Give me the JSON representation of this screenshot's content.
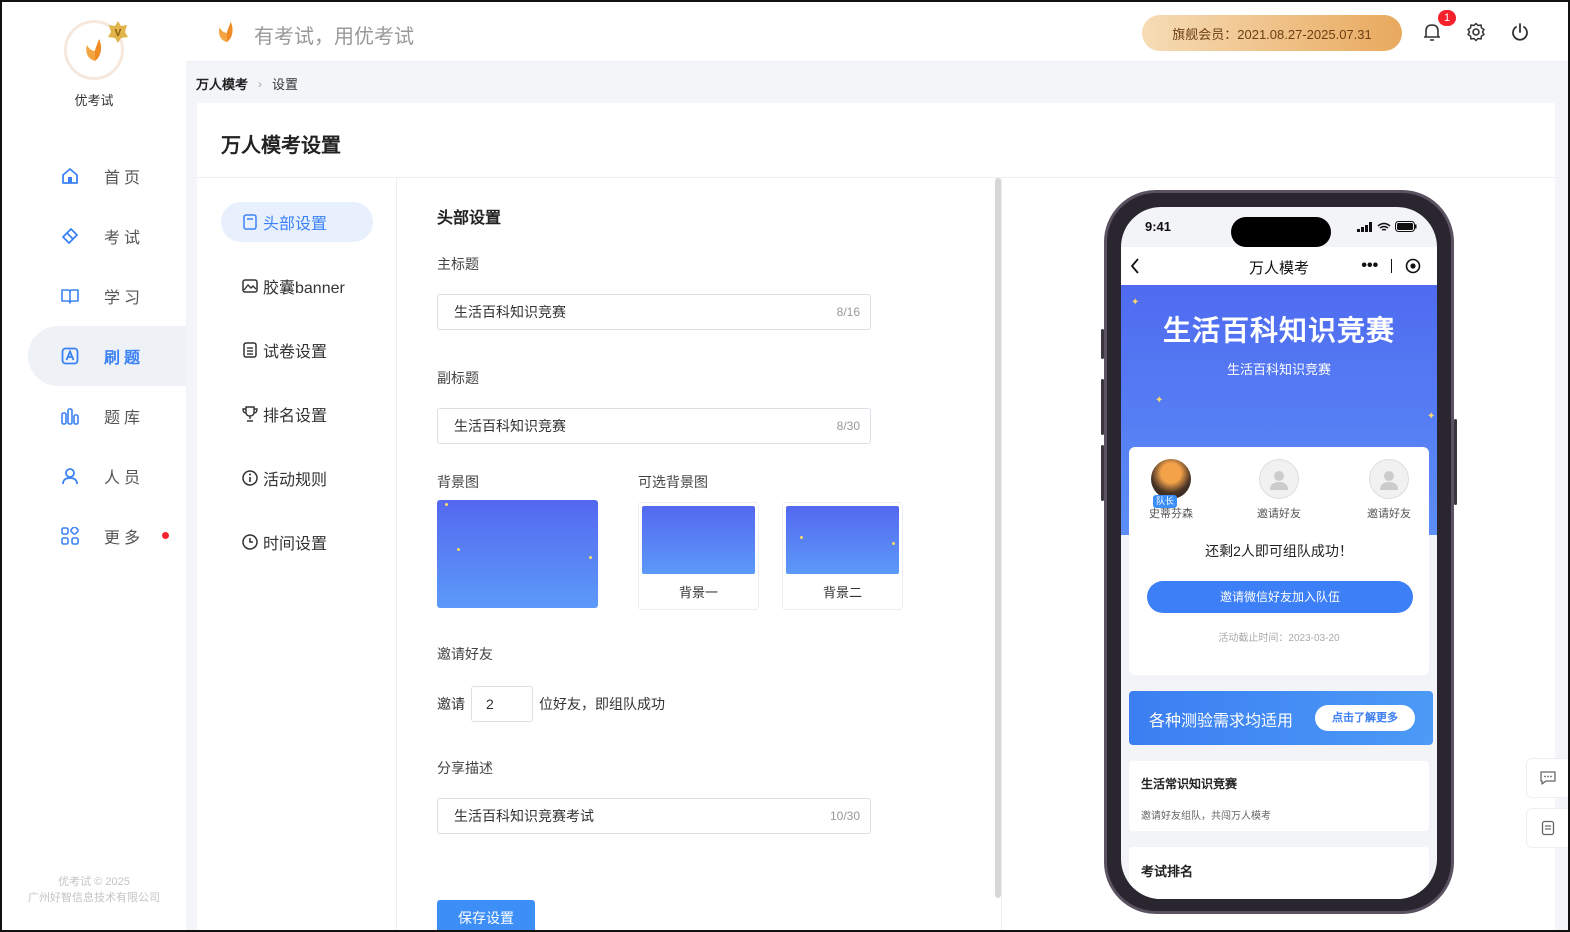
{
  "brand": {
    "name": "优考试",
    "slogan": "有考试，用优考试",
    "copyright_line1": "优考试 © 2025",
    "copyright_line2": "广州好智信息技术有限公司",
    "accent_color": "#3b82f6"
  },
  "sidebar": {
    "items": [
      {
        "label": "首页",
        "icon": "home-icon",
        "active": false
      },
      {
        "label": "考试",
        "icon": "eraser-icon",
        "active": false
      },
      {
        "label": "学习",
        "icon": "book-icon",
        "active": false
      },
      {
        "label": "刷题",
        "icon": "a-box-icon",
        "active": true
      },
      {
        "label": "题库",
        "icon": "bars-icon",
        "active": false
      },
      {
        "label": "人员",
        "icon": "user-icon",
        "active": false
      },
      {
        "label": "更多",
        "icon": "grid-icon",
        "active": false,
        "has_dot": true
      }
    ]
  },
  "header": {
    "vip_text": "旗舰会员：2021.08.27-2025.07.31",
    "notification_count": "1"
  },
  "breadcrumb": {
    "items": [
      "万人模考",
      "设置"
    ]
  },
  "page": {
    "title": "万人模考设置"
  },
  "settings_menu": {
    "items": [
      {
        "label": "头部设置",
        "icon": "doc-icon",
        "active": true
      },
      {
        "label": "胶囊banner",
        "icon": "image-icon",
        "active": false
      },
      {
        "label": "试卷设置",
        "icon": "list-icon",
        "active": false
      },
      {
        "label": "排名设置",
        "icon": "trophy-icon",
        "active": false
      },
      {
        "label": "活动规则",
        "icon": "info-icon",
        "active": false
      },
      {
        "label": "时间设置",
        "icon": "clock-icon",
        "active": false
      }
    ]
  },
  "form": {
    "section_title": "头部设置",
    "main_title_label": "主标题",
    "main_title_value": "生活百科知识竞赛",
    "main_title_count": "8/16",
    "subtitle_label": "副标题",
    "subtitle_value": "生活百科知识竞赛",
    "subtitle_count": "8/30",
    "bg_label": "背景图",
    "optional_bg_label": "可选背景图",
    "bg_options": [
      "背景一",
      "背景二"
    ],
    "invite_label": "邀请好友",
    "invite_prefix": "邀请",
    "invite_value": "2",
    "invite_suffix": "位好友，即组队成功",
    "share_label": "分享描述",
    "share_value": "生活百科知识竞赛考试",
    "share_count": "10/30",
    "save_button": "保存设置"
  },
  "preview": {
    "time": "9:41",
    "nav_title": "万人模考",
    "hero_title": "生活百科知识竞赛",
    "hero_subtitle": "生活百科知识竞赛",
    "members": [
      {
        "name": "史蒂芬森",
        "leader": true
      },
      {
        "name": "邀请好友",
        "leader": false
      },
      {
        "name": "邀请好友",
        "leader": false
      }
    ],
    "leader_tag": "队长",
    "team_message": "还剩2人即可组队成功！",
    "team_button": "邀请微信好友加入队伍",
    "deadline": "活动截止时间：2023-03-20",
    "promo_text": "各种测验需求均适用",
    "promo_button": "点击了解更多",
    "info_title": "生活常识知识竞赛",
    "info_sub": "邀请好友组队，共闯万人模考",
    "rank_title": "考试排名"
  }
}
